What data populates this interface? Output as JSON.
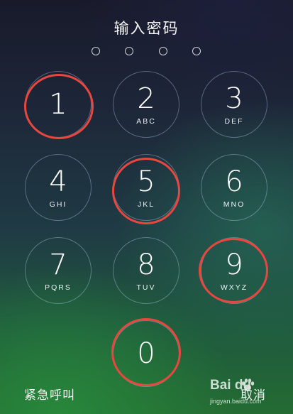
{
  "header": {
    "title": "输入密码"
  },
  "passcode": {
    "entered_count": 0,
    "total_dots": 4
  },
  "keypad": {
    "keys": [
      {
        "digit": "1",
        "letters": ""
      },
      {
        "digit": "2",
        "letters": "ABC"
      },
      {
        "digit": "3",
        "letters": "DEF"
      },
      {
        "digit": "4",
        "letters": "GHI"
      },
      {
        "digit": "5",
        "letters": "JKL"
      },
      {
        "digit": "6",
        "letters": "MNO"
      },
      {
        "digit": "7",
        "letters": "PQRS"
      },
      {
        "digit": "8",
        "letters": "TUV"
      },
      {
        "digit": "9",
        "letters": "WXYZ"
      },
      {
        "digit": "0",
        "letters": ""
      }
    ],
    "highlighted_digits": [
      "1",
      "5",
      "9",
      "0"
    ]
  },
  "footer": {
    "emergency_label": "紧急呼叫",
    "cancel_label": "取消"
  },
  "watermark": {
    "brand": "Bai du",
    "site": "jingyan.baidu.com"
  },
  "colors": {
    "highlight_ring": "#e8463f",
    "key_border": "rgba(200,220,255,0.35)",
    "text": "#ffffff"
  }
}
